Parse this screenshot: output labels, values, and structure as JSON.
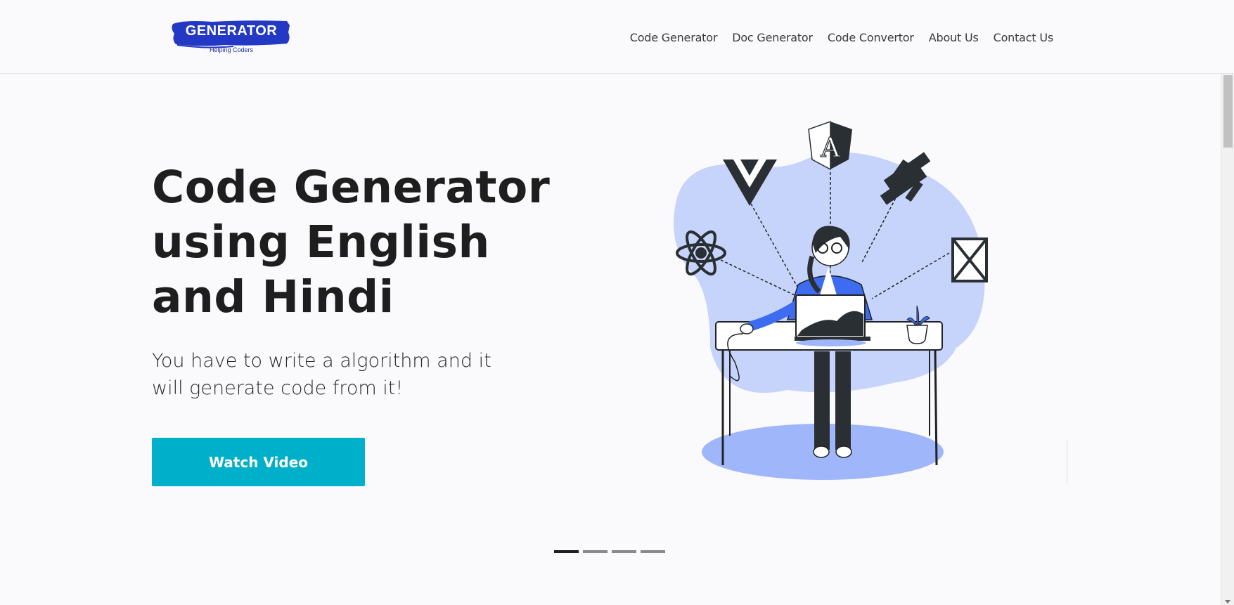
{
  "brand": {
    "name": "GENERATOR",
    "tagline": "Helping Coders",
    "color": "#2338c4"
  },
  "nav": {
    "items": [
      {
        "label": "Code Generator"
      },
      {
        "label": "Doc Generator"
      },
      {
        "label": "Code Convertor"
      },
      {
        "label": "About Us"
      },
      {
        "label": "Contact Us"
      }
    ]
  },
  "hero": {
    "title": "Code Generator using English and Hindi",
    "subtitle": "You have to write a algorithm and it will generate code from it!",
    "cta_label": "Watch Video",
    "cta_color": "#00afc9",
    "illustration_icons": [
      "vue-icon",
      "angular-icon",
      "ember-icon",
      "react-icon",
      "codepen-icon"
    ]
  },
  "carousel": {
    "slide_count": 4,
    "active_index": 0
  }
}
